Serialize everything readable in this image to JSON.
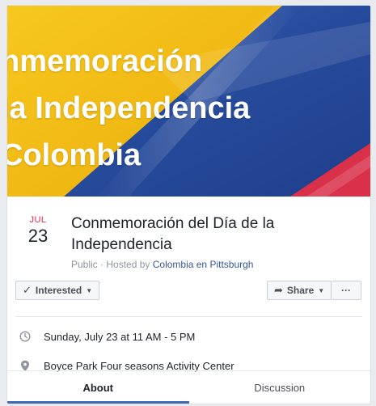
{
  "cover": {
    "lines": [
      "nmemoración",
      "la Independencia",
      "Colombia"
    ],
    "flag_colors": {
      "yellow": "#f4c21b",
      "blue": "#2a4fa3",
      "red": "#d9314a"
    }
  },
  "event": {
    "month": "JUL",
    "day": "23",
    "title": "Conmemoración del Día de la Independencia",
    "privacy": "Public",
    "hosted_prefix": "· Hosted by",
    "host": "Colombia en Pittsburgh"
  },
  "actions": {
    "interested_label": "Interested",
    "share_label": "Share",
    "more_label": "···"
  },
  "details": {
    "datetime": "Sunday, July 23 at 11 AM - 5 PM",
    "location": "Boyce Park Four seasons Activity Center"
  },
  "tabs": [
    {
      "label": "About",
      "active": true
    },
    {
      "label": "Discussion",
      "active": false
    }
  ],
  "colors": {
    "accent": "#4267b2",
    "date_red": "#f02849",
    "link": "#365899"
  }
}
